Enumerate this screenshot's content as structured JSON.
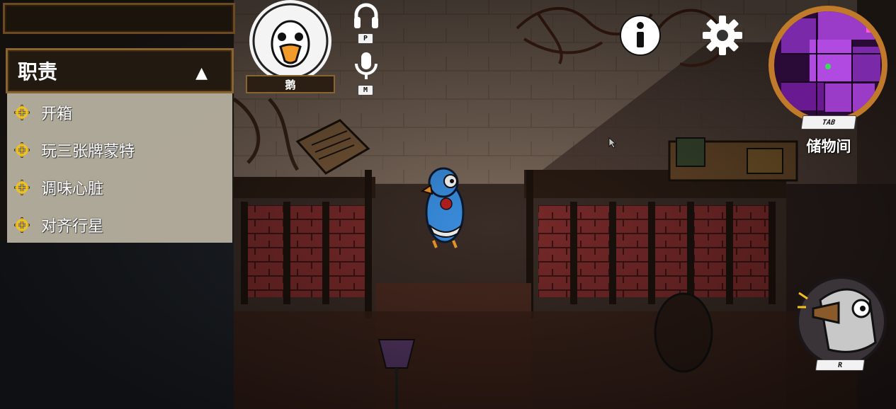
{
  "hud": {
    "objectives_title": "职责",
    "objectives_toggle": "▲",
    "tasks": [
      {
        "label": "开箱"
      },
      {
        "label": "玩三张牌蒙特"
      },
      {
        "label": "调味心脏"
      },
      {
        "label": "对齐行星"
      }
    ],
    "player_role": "鹅",
    "voice_keys": {
      "audio": "P",
      "mic": "M"
    },
    "icons": {
      "task": "crosshair-icon",
      "audio": "headphones-icon",
      "mic": "microphone-icon",
      "info": "info-icon",
      "settings": "gear-icon",
      "report": "report-ability-icon"
    }
  },
  "minimap": {
    "key": "TAB",
    "current_room": "储物间"
  },
  "ability": {
    "key": "R"
  },
  "colors": {
    "frame_gold": "#8a6430",
    "task_panel": "#bab4a4",
    "minimap_purple": "#9a3cc8",
    "player_blue": "#3a8ee0"
  }
}
